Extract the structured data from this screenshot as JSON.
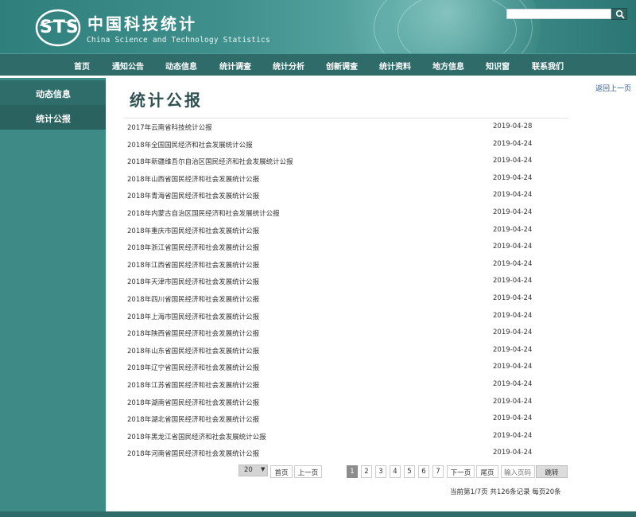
{
  "header": {
    "logo": "STS",
    "cn_title": "中国科技统计",
    "en_title": "China Science and Technology Statistics",
    "search_placeholder": ""
  },
  "nav": [
    {
      "label": "首页"
    },
    {
      "label": "通知公告"
    },
    {
      "label": "动态信息"
    },
    {
      "label": "统计调查"
    },
    {
      "label": "统计分析"
    },
    {
      "label": "创新调查"
    },
    {
      "label": "统计资料"
    },
    {
      "label": "地方信息"
    },
    {
      "label": "知识窗"
    },
    {
      "label": "联系我们"
    }
  ],
  "sidebar": {
    "items": [
      {
        "label": "动态信息"
      },
      {
        "label": "统计公报"
      }
    ]
  },
  "main": {
    "back_link": "返回上一页",
    "title": "统计公报",
    "rows": [
      {
        "title": "2017年云南省科技统计公报",
        "date": "2019-04-28"
      },
      {
        "title": "2018年全国国民经济和社会发展统计公报",
        "date": "2019-04-24"
      },
      {
        "title": "2018年新疆维吾尔自治区国民经济和社会发展统计公报",
        "date": "2019-04-24"
      },
      {
        "title": "2018年山西省国民经济和社会发展统计公报",
        "date": "2019-04-24"
      },
      {
        "title": "2018年青海省国民经济和社会发展统计公报",
        "date": "2019-04-24"
      },
      {
        "title": "2018年内蒙古自治区国民经济和社会发展统计公报",
        "date": "2019-04-24"
      },
      {
        "title": "2018年重庆市国民经济和社会发展统计公报",
        "date": "2019-04-24"
      },
      {
        "title": "2018年浙江省国民经济和社会发展统计公报",
        "date": "2019-04-24"
      },
      {
        "title": "2018年江西省国民经济和社会发展统计公报",
        "date": "2019-04-24"
      },
      {
        "title": "2018年天津市国民经济和社会发展统计公报",
        "date": "2019-04-24"
      },
      {
        "title": "2018年四川省国民经济和社会发展统计公报",
        "date": "2019-04-24"
      },
      {
        "title": "2018年上海市国民经济和社会发展统计公报",
        "date": "2019-04-24"
      },
      {
        "title": "2018年陕西省国民经济和社会发展统计公报",
        "date": "2019-04-24"
      },
      {
        "title": "2018年山东省国民经济和社会发展统计公报",
        "date": "2019-04-24"
      },
      {
        "title": "2018年辽宁省国民经济和社会发展统计公报",
        "date": "2019-04-24"
      },
      {
        "title": "2018年江苏省国民经济和社会发展统计公报",
        "date": "2019-04-24"
      },
      {
        "title": "2018年湖南省国民经济和社会发展统计公报",
        "date": "2019-04-24"
      },
      {
        "title": "2018年湖北省国民经济和社会发展统计公报",
        "date": "2019-04-24"
      },
      {
        "title": "2018年黑龙江省国民经济和社会发展统计公报",
        "date": "2019-04-24"
      },
      {
        "title": "2018年河南省国民经济和社会发展统计公报",
        "date": "2019-04-24"
      }
    ]
  },
  "pagination": {
    "page_size": "20",
    "first": "首页",
    "prev": "上一页",
    "pages": [
      "1",
      "2",
      "3",
      "4",
      "5",
      "6",
      "7"
    ],
    "current_page": "1",
    "next": "下一页",
    "last": "尾页",
    "input_placeholder": "输入页码",
    "go": "跳转",
    "summary": "当前第1/7页 共126条记录 每页20条"
  },
  "colors": {
    "header_teal": "#3f8f8c",
    "nav_teal": "#2e6b69",
    "sidebar_teal": "#3e8a87",
    "title_color": "#2f5152"
  }
}
